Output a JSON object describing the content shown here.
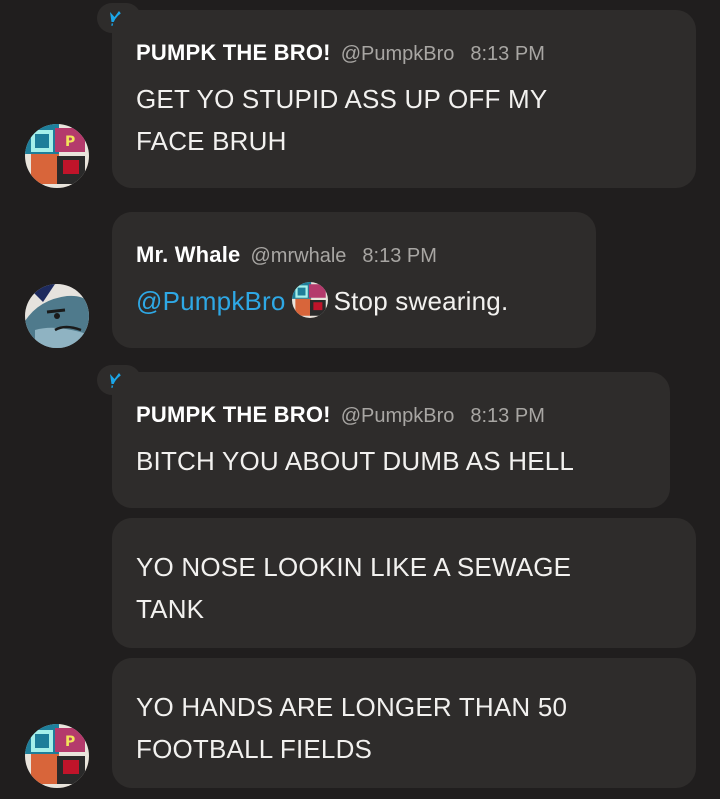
{
  "colors": {
    "background": "#201e1e",
    "bubble": "#2e2c2b",
    "mention": "#2ea8e5",
    "crown": "#1ba6e8",
    "meta_text": "#a8a6a3"
  },
  "messages": [
    {
      "name": "PUMPK THE BRO!",
      "handle": "@PumpkBro",
      "time": "8:13 PM",
      "lines": [
        "GET YO STUPID ASS UP OFF MY",
        "FACE BRUH"
      ],
      "badge_icon": "crown-icon"
    },
    {
      "name": "Mr. Whale",
      "handle": "@mrwhale",
      "time": "8:13 PM",
      "mention": "@PumpkBro",
      "text": "Stop swearing."
    },
    {
      "name": "PUMPK THE BRO!",
      "handle": "@PumpkBro",
      "time": "8:13 PM",
      "lines": [
        "BITCH YOU ABOUT DUMB AS HELL"
      ],
      "badge_icon": "crown-icon"
    },
    {
      "lines": [
        "YO NOSE LOOKIN LIKE A SEWAGE",
        "TANK"
      ]
    },
    {
      "lines": [
        "YO HANDS ARE LONGER THAN 50",
        "FOOTBALL FIELDS"
      ]
    }
  ]
}
